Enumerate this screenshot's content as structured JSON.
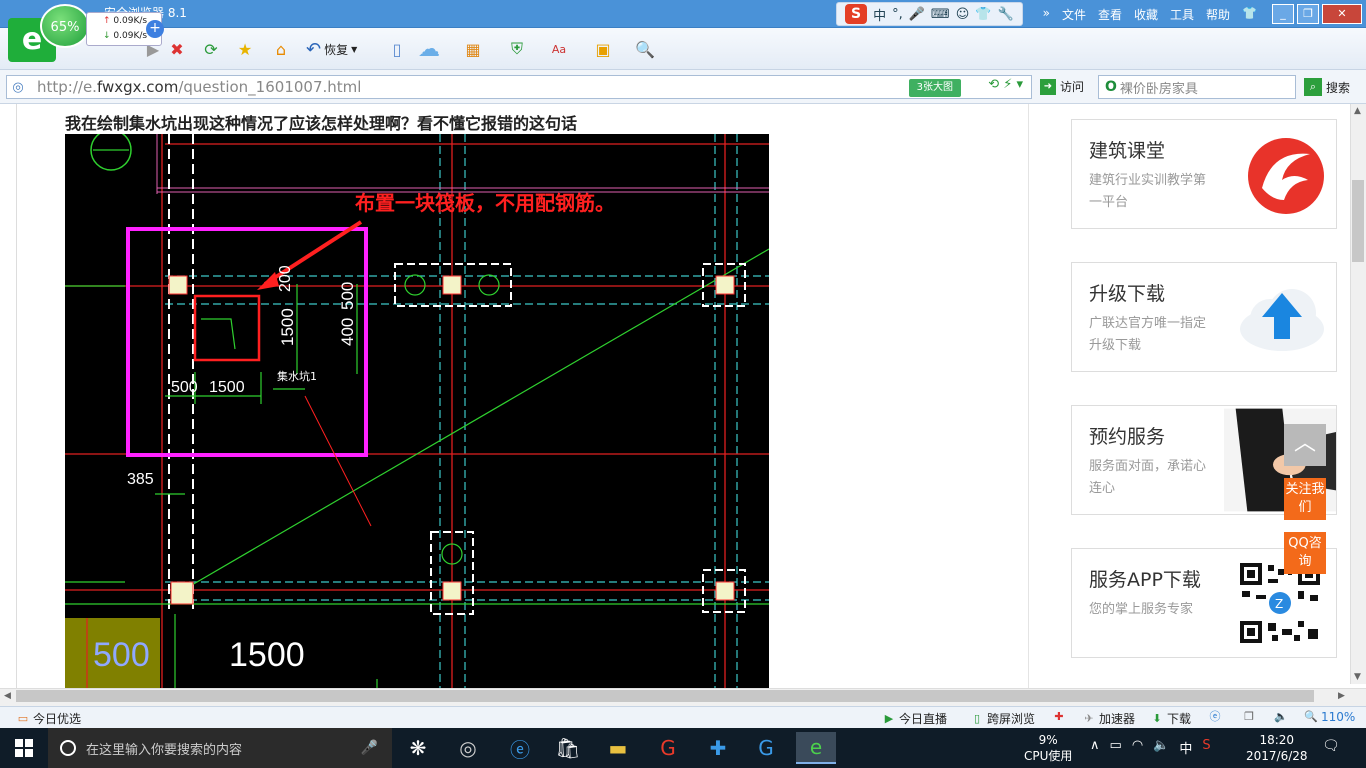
{
  "window": {
    "title": "…安全浏览器 8.1",
    "menu": [
      "文件",
      "查看",
      "收藏",
      "工具",
      "帮助"
    ],
    "ime_labels": [
      "中",
      "°,"
    ]
  },
  "speed": {
    "percent": "65%",
    "up": "0.09K/s",
    "down": "0.09K/s",
    "label": "后退"
  },
  "toolbar": {
    "restore_label": "恢复"
  },
  "address": {
    "url_prefix": "http://e.",
    "url_domain": "fwxgx.com",
    "url_path": "/question_1601007.html",
    "big_image_label": "3张大图",
    "visit_label": "访问",
    "search_placeholder": "裸价卧房家具",
    "search_button": "搜索"
  },
  "page": {
    "question_title": "我在绘制集水坑出现这种情况了应该怎样处理啊？看不懂它报错的这句话",
    "cad_annotation": "布置一块筏板，不用配钢筋。",
    "cad_labels": {
      "d200": "200",
      "d1500v": "1500",
      "d500r": "500",
      "d400": "400",
      "d500b": "500",
      "d1500b": "1500",
      "d385": "385",
      "jsk": "集水坑1",
      "big500": "500",
      "big1500": "1500"
    }
  },
  "sidebar": {
    "cards": [
      {
        "title": "建筑课堂",
        "desc": "建筑行业实训教学第一平台",
        "icon": "flame-logo-icon"
      },
      {
        "title": "升级下载",
        "desc": "广联达官方唯一指定升级下载",
        "icon": "cloud-upload-icon"
      },
      {
        "title": "预约服务",
        "desc": "服务面对面，承诺心连心",
        "icon": "handshake-icon"
      },
      {
        "title": "服务APP下载",
        "desc": "您的掌上服务专家",
        "icon": "qr-code-icon"
      }
    ],
    "float_follow": "关注我们",
    "float_qq": "QQ咨询"
  },
  "statusbar": {
    "today": "今日优选",
    "live": "今日直播",
    "cross": "跨屏浏览",
    "accel": "加速器",
    "download": "下载",
    "zoom": "110%"
  },
  "taskbar": {
    "search_placeholder": "在这里输入你要搜索的内容",
    "cpu_percent": "9%",
    "cpu_label": "CPU使用",
    "ime": "中",
    "time": "18:20",
    "date": "2017/6/28"
  }
}
